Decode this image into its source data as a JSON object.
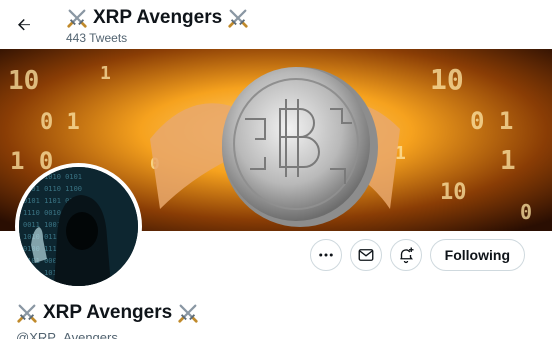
{
  "header": {
    "back_icon": "arrow-left-icon",
    "title": "XRP Avengers",
    "title_emoji_icon": "crossed-swords-icon",
    "tweet_count": "443 Tweets"
  },
  "banner": {
    "description_icon": "crypto-coin-banner"
  },
  "avatar": {
    "icon": "hooded-hacker-avatar"
  },
  "actions": {
    "more_icon": "more-horizontal-icon",
    "message_icon": "mail-icon",
    "notify_icon": "bell-plus-icon",
    "follow_label": "Following"
  },
  "profile": {
    "name": "XRP Avengers",
    "handle": "@XRP_Avengers"
  },
  "colors": {
    "text_primary": "#0f1419",
    "text_secondary": "#536471",
    "border": "#cfd9de",
    "banner_gold": "#f6a21e"
  }
}
